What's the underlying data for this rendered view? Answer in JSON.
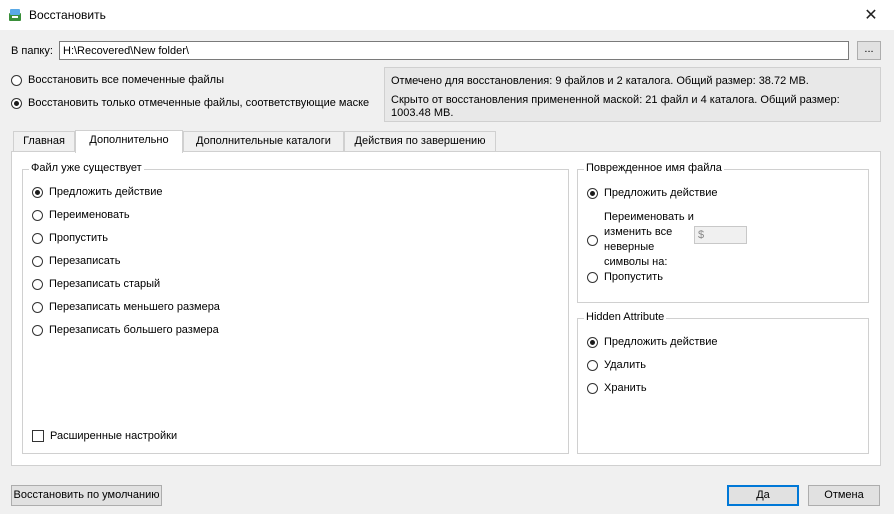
{
  "window": {
    "title": "Восстановить",
    "close_glyph": "✕"
  },
  "folder": {
    "label": "В папку:",
    "value": "H:\\Recovered\\New folder\\",
    "browse_label": "..."
  },
  "scope": {
    "options": [
      {
        "label": "Восстановить все помеченные файлы",
        "selected": false
      },
      {
        "label": "Восстановить только отмеченные файлы, соответствующие маске",
        "selected": true
      }
    ]
  },
  "info": {
    "line1": "Отмечено для восстановления: 9 файлов и 2 каталога. Общий размер: 38.72 MB.",
    "line2": "Скрыто от восстановления примененной маской: 21 файл и 4 каталога. Общий размер: 1003.48 MB."
  },
  "tabs": [
    {
      "label": "Главная",
      "active": false
    },
    {
      "label": "Дополнительно",
      "active": true
    },
    {
      "label": "Дополнительные каталоги",
      "active": false
    },
    {
      "label": "Действия по завершению",
      "active": false
    }
  ],
  "file_exists": {
    "title": "Файл уже существует",
    "options": [
      {
        "label": "Предложить действие",
        "selected": true
      },
      {
        "label": "Переименовать",
        "selected": false
      },
      {
        "label": "Пропустить",
        "selected": false
      },
      {
        "label": "Перезаписать",
        "selected": false
      },
      {
        "label": "Перезаписать старый",
        "selected": false
      },
      {
        "label": "Перезаписать меньшего размера",
        "selected": false
      },
      {
        "label": "Перезаписать большего размера",
        "selected": false
      }
    ],
    "advanced": {
      "label": "Расширенные настройки",
      "checked": false
    }
  },
  "damaged_name": {
    "title": "Поврежденное имя файла",
    "options": [
      {
        "label": "Предложить действие",
        "selected": true
      },
      {
        "label": "Переименовать и изменить все неверные символы на:",
        "selected": false
      },
      {
        "label": "Пропустить",
        "selected": false
      }
    ],
    "replace_value": "$"
  },
  "hidden_attr": {
    "title": "Hidden Attribute",
    "options": [
      {
        "label": "Предложить действие",
        "selected": true
      },
      {
        "label": "Удалить",
        "selected": false
      },
      {
        "label": "Хранить",
        "selected": false
      }
    ]
  },
  "buttons": {
    "defaults": "Восстановить по умолчанию",
    "ok": "Да",
    "cancel": "Отмена"
  }
}
